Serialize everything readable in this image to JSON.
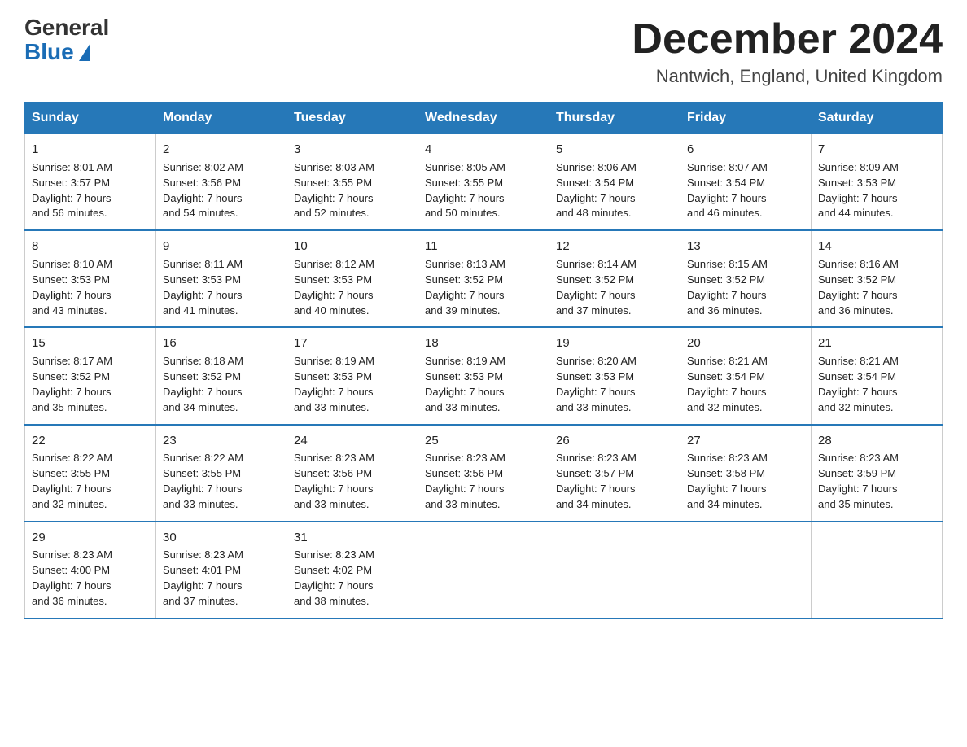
{
  "header": {
    "logo_general": "General",
    "logo_blue": "Blue",
    "month_title": "December 2024",
    "location": "Nantwich, England, United Kingdom"
  },
  "days_of_week": [
    "Sunday",
    "Monday",
    "Tuesday",
    "Wednesday",
    "Thursday",
    "Friday",
    "Saturday"
  ],
  "weeks": [
    [
      {
        "day": "1",
        "info": "Sunrise: 8:01 AM\nSunset: 3:57 PM\nDaylight: 7 hours\nand 56 minutes."
      },
      {
        "day": "2",
        "info": "Sunrise: 8:02 AM\nSunset: 3:56 PM\nDaylight: 7 hours\nand 54 minutes."
      },
      {
        "day": "3",
        "info": "Sunrise: 8:03 AM\nSunset: 3:55 PM\nDaylight: 7 hours\nand 52 minutes."
      },
      {
        "day": "4",
        "info": "Sunrise: 8:05 AM\nSunset: 3:55 PM\nDaylight: 7 hours\nand 50 minutes."
      },
      {
        "day": "5",
        "info": "Sunrise: 8:06 AM\nSunset: 3:54 PM\nDaylight: 7 hours\nand 48 minutes."
      },
      {
        "day": "6",
        "info": "Sunrise: 8:07 AM\nSunset: 3:54 PM\nDaylight: 7 hours\nand 46 minutes."
      },
      {
        "day": "7",
        "info": "Sunrise: 8:09 AM\nSunset: 3:53 PM\nDaylight: 7 hours\nand 44 minutes."
      }
    ],
    [
      {
        "day": "8",
        "info": "Sunrise: 8:10 AM\nSunset: 3:53 PM\nDaylight: 7 hours\nand 43 minutes."
      },
      {
        "day": "9",
        "info": "Sunrise: 8:11 AM\nSunset: 3:53 PM\nDaylight: 7 hours\nand 41 minutes."
      },
      {
        "day": "10",
        "info": "Sunrise: 8:12 AM\nSunset: 3:53 PM\nDaylight: 7 hours\nand 40 minutes."
      },
      {
        "day": "11",
        "info": "Sunrise: 8:13 AM\nSunset: 3:52 PM\nDaylight: 7 hours\nand 39 minutes."
      },
      {
        "day": "12",
        "info": "Sunrise: 8:14 AM\nSunset: 3:52 PM\nDaylight: 7 hours\nand 37 minutes."
      },
      {
        "day": "13",
        "info": "Sunrise: 8:15 AM\nSunset: 3:52 PM\nDaylight: 7 hours\nand 36 minutes."
      },
      {
        "day": "14",
        "info": "Sunrise: 8:16 AM\nSunset: 3:52 PM\nDaylight: 7 hours\nand 36 minutes."
      }
    ],
    [
      {
        "day": "15",
        "info": "Sunrise: 8:17 AM\nSunset: 3:52 PM\nDaylight: 7 hours\nand 35 minutes."
      },
      {
        "day": "16",
        "info": "Sunrise: 8:18 AM\nSunset: 3:52 PM\nDaylight: 7 hours\nand 34 minutes."
      },
      {
        "day": "17",
        "info": "Sunrise: 8:19 AM\nSunset: 3:53 PM\nDaylight: 7 hours\nand 33 minutes."
      },
      {
        "day": "18",
        "info": "Sunrise: 8:19 AM\nSunset: 3:53 PM\nDaylight: 7 hours\nand 33 minutes."
      },
      {
        "day": "19",
        "info": "Sunrise: 8:20 AM\nSunset: 3:53 PM\nDaylight: 7 hours\nand 33 minutes."
      },
      {
        "day": "20",
        "info": "Sunrise: 8:21 AM\nSunset: 3:54 PM\nDaylight: 7 hours\nand 32 minutes."
      },
      {
        "day": "21",
        "info": "Sunrise: 8:21 AM\nSunset: 3:54 PM\nDaylight: 7 hours\nand 32 minutes."
      }
    ],
    [
      {
        "day": "22",
        "info": "Sunrise: 8:22 AM\nSunset: 3:55 PM\nDaylight: 7 hours\nand 32 minutes."
      },
      {
        "day": "23",
        "info": "Sunrise: 8:22 AM\nSunset: 3:55 PM\nDaylight: 7 hours\nand 33 minutes."
      },
      {
        "day": "24",
        "info": "Sunrise: 8:23 AM\nSunset: 3:56 PM\nDaylight: 7 hours\nand 33 minutes."
      },
      {
        "day": "25",
        "info": "Sunrise: 8:23 AM\nSunset: 3:56 PM\nDaylight: 7 hours\nand 33 minutes."
      },
      {
        "day": "26",
        "info": "Sunrise: 8:23 AM\nSunset: 3:57 PM\nDaylight: 7 hours\nand 34 minutes."
      },
      {
        "day": "27",
        "info": "Sunrise: 8:23 AM\nSunset: 3:58 PM\nDaylight: 7 hours\nand 34 minutes."
      },
      {
        "day": "28",
        "info": "Sunrise: 8:23 AM\nSunset: 3:59 PM\nDaylight: 7 hours\nand 35 minutes."
      }
    ],
    [
      {
        "day": "29",
        "info": "Sunrise: 8:23 AM\nSunset: 4:00 PM\nDaylight: 7 hours\nand 36 minutes."
      },
      {
        "day": "30",
        "info": "Sunrise: 8:23 AM\nSunset: 4:01 PM\nDaylight: 7 hours\nand 37 minutes."
      },
      {
        "day": "31",
        "info": "Sunrise: 8:23 AM\nSunset: 4:02 PM\nDaylight: 7 hours\nand 38 minutes."
      },
      {
        "day": "",
        "info": ""
      },
      {
        "day": "",
        "info": ""
      },
      {
        "day": "",
        "info": ""
      },
      {
        "day": "",
        "info": ""
      }
    ]
  ]
}
